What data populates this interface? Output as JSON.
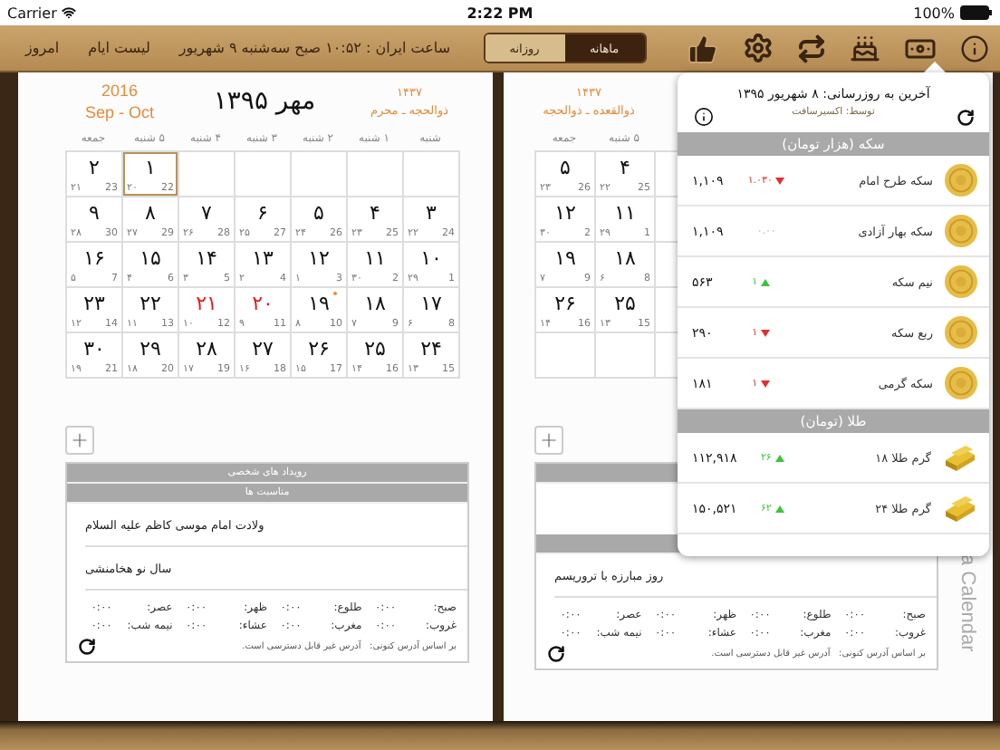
{
  "status_bar": {
    "carrier": "Carrier",
    "time": "2:22 PM",
    "battery": "100%"
  },
  "toolbar": {
    "today": "امروز",
    "days_list": "لیست ایام",
    "clock": "ساعت ایران : ۱۰:۵۲ صبح سه‌شنبه ۹ شهریور",
    "view_tabs": [
      {
        "label": "ماهانه",
        "selected": true
      },
      {
        "label": "روزانه",
        "selected": false
      }
    ]
  },
  "left_page": {
    "gregorian_year": "2016",
    "gregorian_months": "Sep - Oct",
    "title": "مهر ۱۳۹۵",
    "hijri_year": "۱۴۳۷",
    "hijri_months": "ذوالحجه ـ محرم",
    "weekdays": [
      "شنبه",
      "۱ شنبه",
      "۲ شنبه",
      "۳ شنبه",
      "۴ شنبه",
      "۵ شنبه",
      "جمعه"
    ],
    "weeks": [
      [
        {
          "kind": "empty"
        },
        {
          "kind": "empty"
        },
        {
          "kind": "empty"
        },
        {
          "kind": "empty"
        },
        {
          "kind": "empty"
        },
        {
          "kind": "day",
          "day": "۱",
          "hijri": "۲۰",
          "gregorian": "22",
          "selected": true,
          "holiday": false,
          "event": false
        },
        {
          "kind": "day",
          "day": "۲",
          "hijri": "۲۱",
          "gregorian": "23",
          "selected": false,
          "holiday": false,
          "event": false
        }
      ],
      [
        {
          "kind": "day",
          "day": "۳",
          "hijri": "۲۲",
          "gregorian": "24",
          "selected": false,
          "holiday": false,
          "event": false
        },
        {
          "kind": "day",
          "day": "۴",
          "hijri": "۲۳",
          "gregorian": "25",
          "selected": false,
          "holiday": false,
          "event": false
        },
        {
          "kind": "day",
          "day": "۵",
          "hijri": "۲۴",
          "gregorian": "26",
          "selected": false,
          "holiday": false,
          "event": false
        },
        {
          "kind": "day",
          "day": "۶",
          "hijri": "۲۵",
          "gregorian": "27",
          "selected": false,
          "holiday": false,
          "event": false
        },
        {
          "kind": "day",
          "day": "۷",
          "hijri": "۲۶",
          "gregorian": "28",
          "selected": false,
          "holiday": false,
          "event": false
        },
        {
          "kind": "day",
          "day": "۸",
          "hijri": "۲۷",
          "gregorian": "29",
          "selected": false,
          "holiday": false,
          "event": false
        },
        {
          "kind": "day",
          "day": "۹",
          "hijri": "۲۸",
          "gregorian": "30",
          "selected": false,
          "holiday": false,
          "event": false
        }
      ],
      [
        {
          "kind": "day",
          "day": "۱۰",
          "hijri": "۲۹",
          "gregorian": "1",
          "selected": false,
          "holiday": false,
          "event": false
        },
        {
          "kind": "day",
          "day": "۱۱",
          "hijri": "۳۰",
          "gregorian": "2",
          "selected": false,
          "holiday": false,
          "event": false
        },
        {
          "kind": "day",
          "day": "۱۲",
          "hijri": "۱",
          "gregorian": "3",
          "selected": false,
          "holiday": false,
          "event": false
        },
        {
          "kind": "day",
          "day": "۱۳",
          "hijri": "۲",
          "gregorian": "4",
          "selected": false,
          "holiday": false,
          "event": false
        },
        {
          "kind": "day",
          "day": "۱۴",
          "hijri": "۳",
          "gregorian": "5",
          "selected": false,
          "holiday": false,
          "event": false
        },
        {
          "kind": "day",
          "day": "۱۵",
          "hijri": "۴",
          "gregorian": "6",
          "selected": false,
          "holiday": false,
          "event": false
        },
        {
          "kind": "day",
          "day": "۱۶",
          "hijri": "۵",
          "gregorian": "7",
          "selected": false,
          "holiday": false,
          "event": false
        }
      ],
      [
        {
          "kind": "day",
          "day": "۱۷",
          "hijri": "۶",
          "gregorian": "8",
          "selected": false,
          "holiday": false,
          "event": false
        },
        {
          "kind": "day",
          "day": "۱۸",
          "hijri": "۷",
          "gregorian": "9",
          "selected": false,
          "holiday": false,
          "event": false
        },
        {
          "kind": "day",
          "day": "۱۹",
          "hijri": "۸",
          "gregorian": "10",
          "selected": false,
          "holiday": false,
          "event": true
        },
        {
          "kind": "day",
          "day": "۲۰",
          "hijri": "۹",
          "gregorian": "11",
          "selected": false,
          "holiday": true,
          "event": false
        },
        {
          "kind": "day",
          "day": "۲۱",
          "hijri": "۱۰",
          "gregorian": "12",
          "selected": false,
          "holiday": true,
          "event": false
        },
        {
          "kind": "day",
          "day": "۲۲",
          "hijri": "۱۱",
          "gregorian": "13",
          "selected": false,
          "holiday": false,
          "event": false
        },
        {
          "kind": "day",
          "day": "۲۳",
          "hijri": "۱۲",
          "gregorian": "14",
          "selected": false,
          "holiday": false,
          "event": false
        }
      ],
      [
        {
          "kind": "day",
          "day": "۲۴",
          "hijri": "۱۳",
          "gregorian": "15",
          "selected": false,
          "holiday": false,
          "event": false
        },
        {
          "kind": "day",
          "day": "۲۵",
          "hijri": "۱۴",
          "gregorian": "16",
          "selected": false,
          "holiday": false,
          "event": false
        },
        {
          "kind": "day",
          "day": "۲۶",
          "hijri": "۱۵",
          "gregorian": "17",
          "selected": false,
          "holiday": false,
          "event": false
        },
        {
          "kind": "day",
          "day": "۲۷",
          "hijri": "۱۶",
          "gregorian": "18",
          "selected": false,
          "holiday": false,
          "event": false
        },
        {
          "kind": "day",
          "day": "۲۸",
          "hijri": "۱۷",
          "gregorian": "19",
          "selected": false,
          "holiday": false,
          "event": false
        },
        {
          "kind": "day",
          "day": "۲۹",
          "hijri": "۱۸",
          "gregorian": "20",
          "selected": false,
          "holiday": false,
          "event": false
        },
        {
          "kind": "day",
          "day": "۳۰",
          "hijri": "۱۹",
          "gregorian": "21",
          "selected": false,
          "holiday": false,
          "event": false
        }
      ]
    ],
    "section_headers": [
      "رویداد های شخصی",
      "مناسبت ها"
    ],
    "events": [
      "ولادت امام موسی کاظم علیه السلام",
      "سال نو هخامنشی"
    ],
    "prayer_times": [
      {
        "label": "صبح:",
        "time": "۰:۰۰"
      },
      {
        "label": "طلوع:",
        "time": "۰:۰۰"
      },
      {
        "label": "ظهر:",
        "time": "۰:۰۰"
      },
      {
        "label": "عصر:",
        "time": "۰:۰۰"
      },
      {
        "label": "غروب:",
        "time": "۰:۰۰"
      },
      {
        "label": "مغرب:",
        "time": "۰:۰۰"
      },
      {
        "label": "عشاء:",
        "time": "۰:۰۰"
      },
      {
        "label": "نیمه شب:",
        "time": "۰:۰۰"
      }
    ],
    "address_label": "بر اساس آدرس کنونی:",
    "address_value": "آدرس غیر قابل دسترسی است."
  },
  "right_page": {
    "hijri_year": "۱۴۳۷",
    "hijri_months": "ذوالقعده ـ ذوالحجه",
    "weekdays": [
      "۵ شنبه",
      "جمعه"
    ],
    "weeks": [
      [
        {
          "kind": "day",
          "day": "۴",
          "hijri": "۲۲",
          "gregorian": "25",
          "selected": false,
          "holiday": false,
          "event": false
        },
        {
          "kind": "day",
          "day": "۵",
          "hijri": "۲۳",
          "gregorian": "26",
          "selected": false,
          "holiday": false,
          "event": false
        }
      ],
      [
        {
          "kind": "day",
          "day": "۱۱",
          "hijri": "۲۹",
          "gregorian": "1",
          "selected": false,
          "holiday": false,
          "event": false
        },
        {
          "kind": "day",
          "day": "۱۲",
          "hijri": "۳۰",
          "gregorian": "2",
          "selected": false,
          "holiday": false,
          "event": false
        }
      ],
      [
        {
          "kind": "day",
          "day": "۱۸",
          "hijri": "۶",
          "gregorian": "8",
          "selected": false,
          "holiday": false,
          "event": false
        },
        {
          "kind": "day",
          "day": "۱۹",
          "hijri": "۷",
          "gregorian": "9",
          "selected": false,
          "holiday": false,
          "event": false
        }
      ],
      [
        {
          "kind": "day",
          "day": "۲۵",
          "hijri": "۱۳",
          "gregorian": "15",
          "selected": false,
          "holiday": false,
          "event": false
        },
        {
          "kind": "day",
          "day": "۲۶",
          "hijri": "۱۴",
          "gregorian": "16",
          "selected": false,
          "holiday": false,
          "event": false
        }
      ],
      [
        {
          "kind": "empty"
        },
        {
          "kind": "empty"
        }
      ]
    ],
    "events": [
      "روز مبارزه با تروریسم"
    ],
    "prayer_times": [
      {
        "label": "صبح:",
        "time": "۰:۰۰"
      },
      {
        "label": "طلوع:",
        "time": "۰:۰۰"
      },
      {
        "label": "ظهر:",
        "time": "۰:۰۰"
      },
      {
        "label": "عصر:",
        "time": "۰:۰۰"
      },
      {
        "label": "غروب:",
        "time": "۰:۰۰"
      },
      {
        "label": "مغرب:",
        "time": "۰:۰۰"
      },
      {
        "label": "عشاء:",
        "time": "۰:۰۰"
      },
      {
        "label": "نیمه شب:",
        "time": "۰:۰۰"
      }
    ],
    "address_label": "بر اساس آدرس کنونی:",
    "address_value": "آدرس غیر قابل دسترسی است.",
    "side_label": "a Calendar"
  },
  "rates_popup": {
    "updated": "آخرین به روزرسانی: ۸ شهریور ۱۳۹۵",
    "by": "توسط: اکسیرسافت",
    "sections": [
      {
        "title": "سکه (هزار تومان)",
        "kind": "coin",
        "rows": [
          {
            "name": "سکه طرح امام",
            "kind": "down",
            "change": "۱.۰۳۰",
            "price": "۱,۱۰۹"
          },
          {
            "name": "سکه بهار آزادی",
            "kind": "none",
            "change": "۰.۰۰",
            "price": "۱,۱۰۹"
          },
          {
            "name": "نیم سکه",
            "kind": "up",
            "change": "۱",
            "price": "۵۶۳"
          },
          {
            "name": "ربع سکه",
            "kind": "down",
            "change": "۱",
            "price": "۲۹۰"
          },
          {
            "name": "سکه گرمی",
            "kind": "down",
            "change": "۱",
            "price": "۱۸۱"
          }
        ]
      },
      {
        "title": "طلا (تومان)",
        "kind": "gold",
        "rows": [
          {
            "name": "گرم طلا ۱۸",
            "kind": "up",
            "change": "۲۶",
            "price": "۱۱۲,۹۱۸"
          },
          {
            "name": "گرم طلا ۲۴",
            "kind": "up",
            "change": "۶۲",
            "price": "۱۵۰,۵۲۱"
          }
        ]
      }
    ]
  }
}
